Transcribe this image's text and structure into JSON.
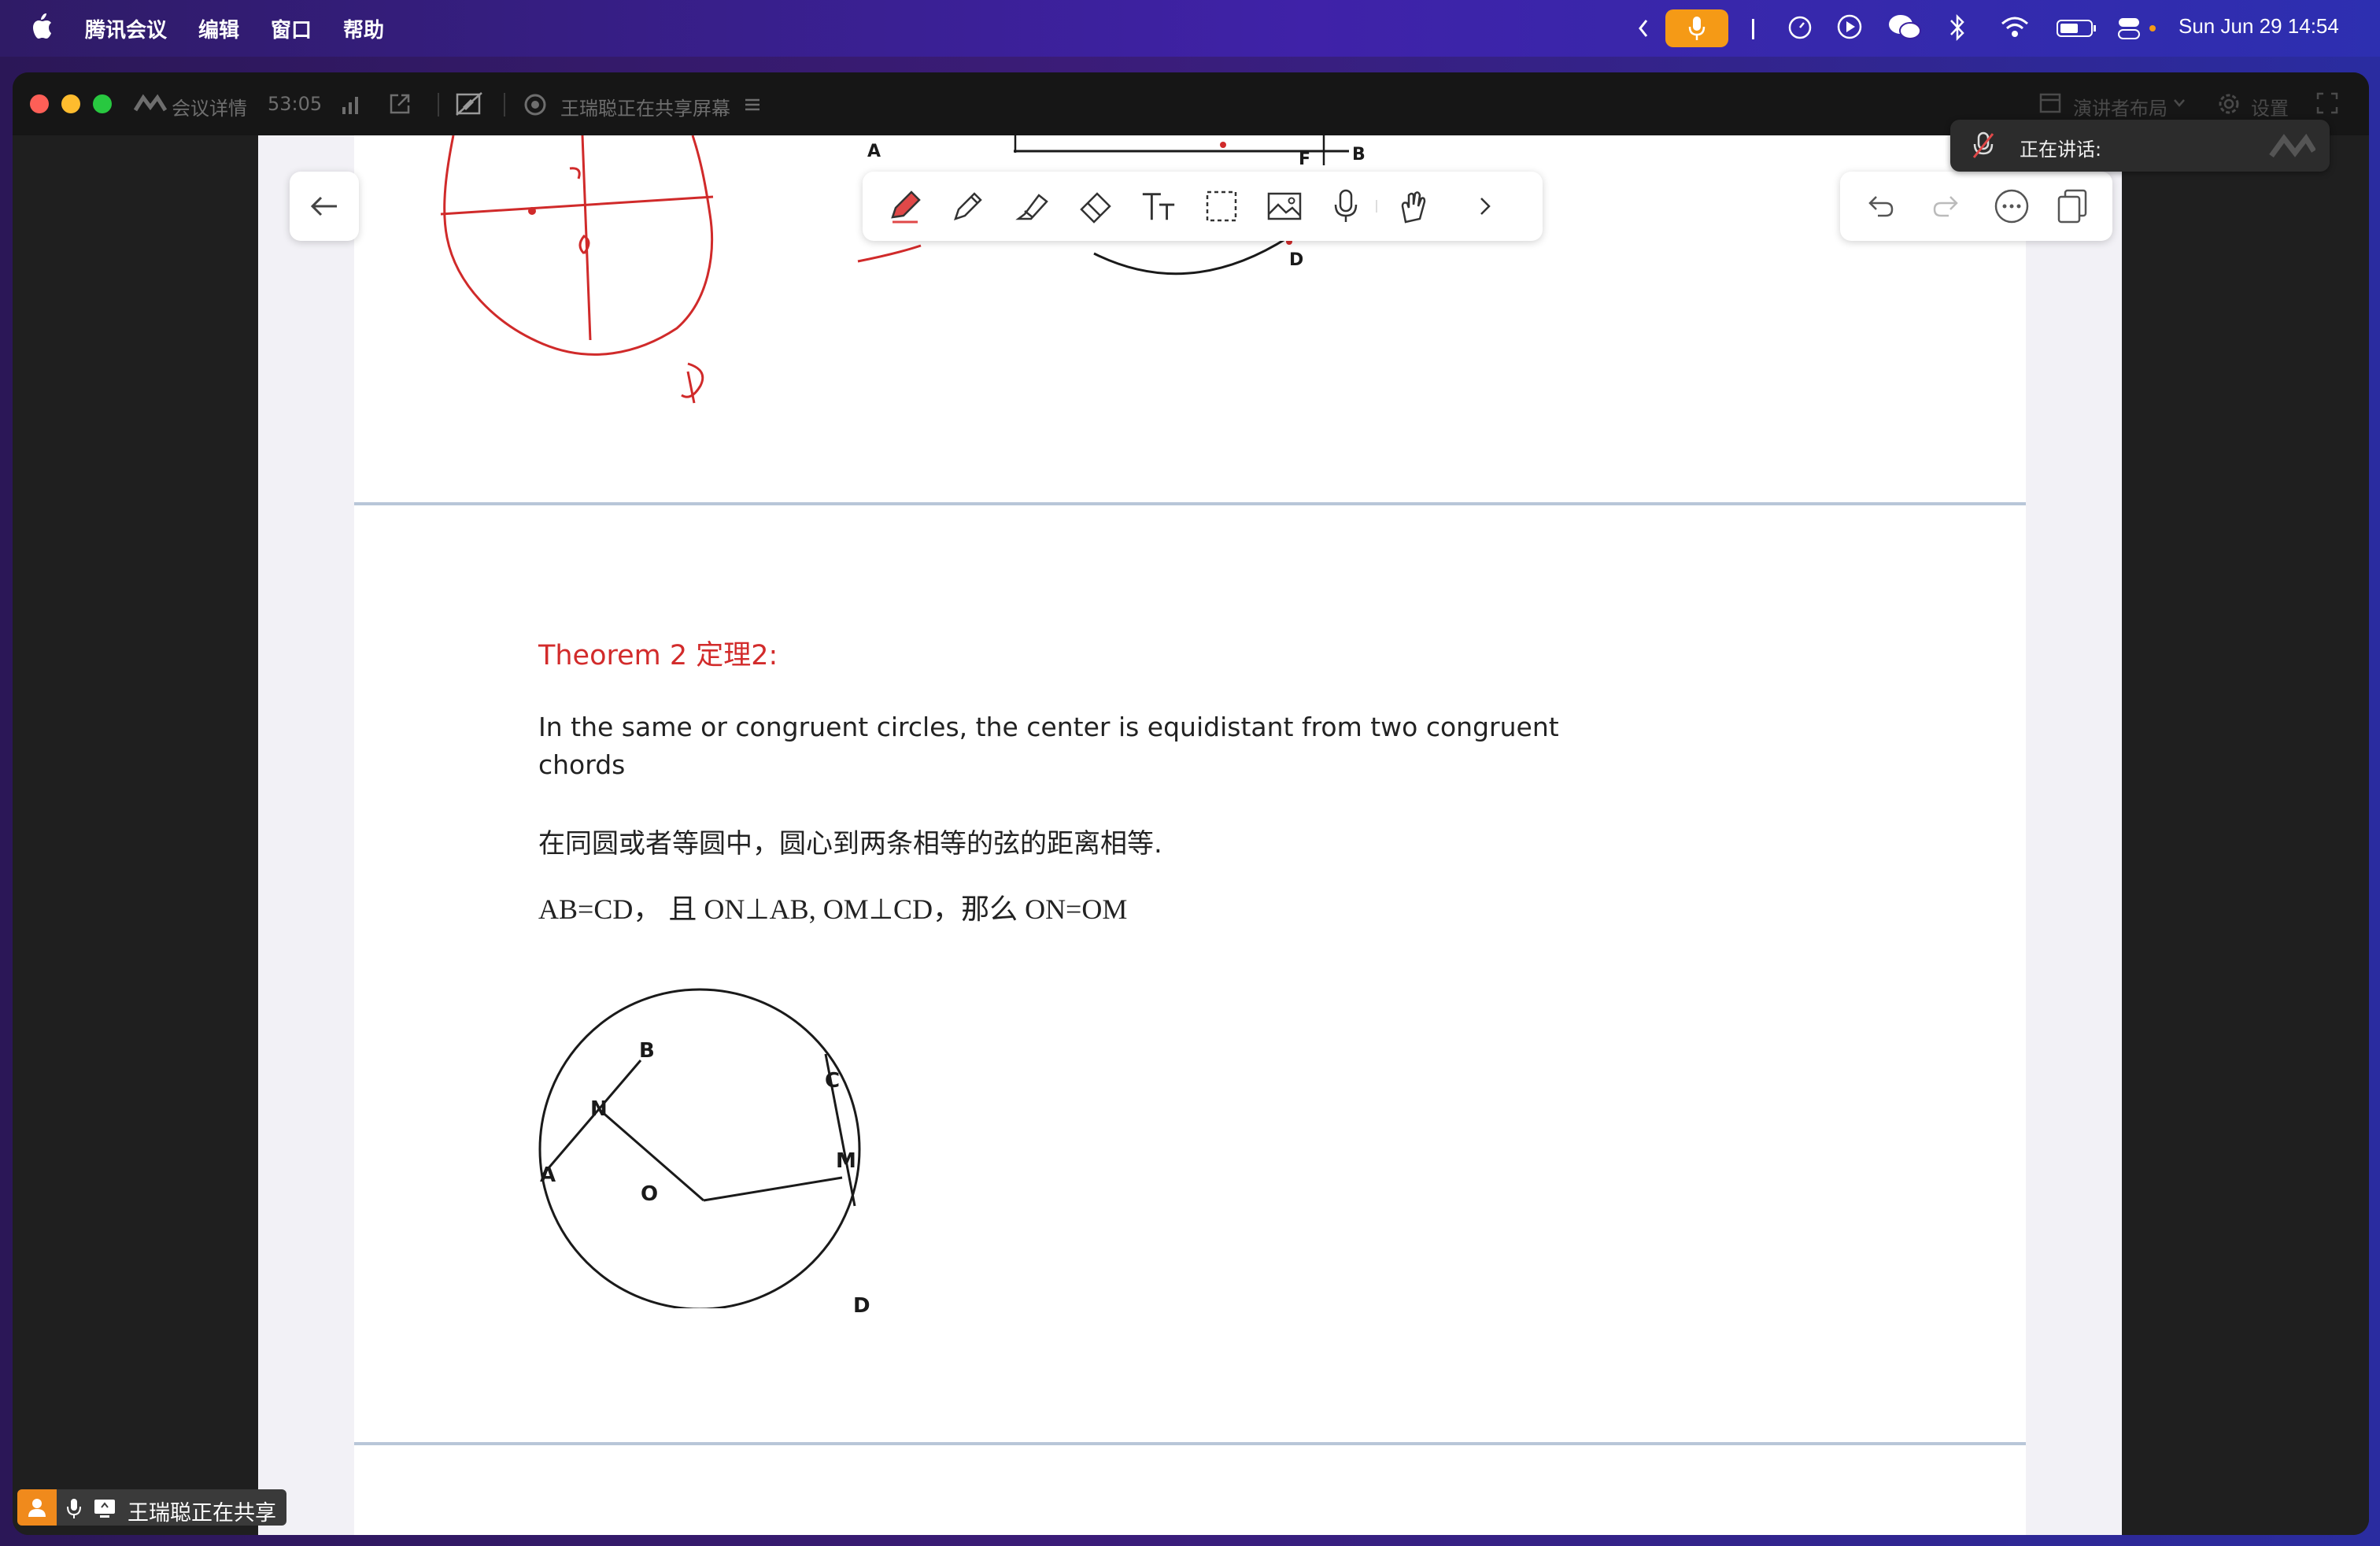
{
  "menubar": {
    "app_name": "腾讯会议",
    "menus": [
      "编辑",
      "窗口",
      "帮助"
    ],
    "clock": "Sun Jun 29  14:54",
    "mic_active_color": "#f59a16"
  },
  "window": {
    "meeting_details_label": "会议详情",
    "meeting_duration": "53:05",
    "sharing_status": "王瑞聪正在共享屏幕",
    "presenter_layout_label": "演讲者布局",
    "settings_label": "设置"
  },
  "speaking_popup": {
    "label": "正在讲话:"
  },
  "whiteboard": {
    "tools": [
      "pen-icon",
      "pencil-icon",
      "highlighter-icon",
      "eraser-icon",
      "text-icon",
      "select-icon",
      "image-icon",
      "mic-icon",
      "laser-hand-icon",
      "chevron-right-icon"
    ],
    "active_tool": "pen-icon",
    "actions": [
      "undo-icon",
      "redo-icon",
      "more-icon",
      "copy-pages-icon"
    ]
  },
  "document": {
    "top_figure_labels": {
      "a": "A",
      "b": "B",
      "f": "F",
      "d": "D"
    },
    "theorem_title": "Theorem 2 定理2:",
    "theorem_en": "In the same or congruent circles, the center is equidistant from two congruent chords",
    "theorem_cn": "在同圆或者等圆中，圆心到两条相等的弦的距离相等.",
    "theorem_eq": "AB=CD，  且 ON⊥AB, OM⊥CD，那么 ON=OM",
    "diagram_labels": {
      "a": "A",
      "b": "B",
      "c": "C",
      "d": "D",
      "m": "M",
      "n": "N",
      "o": "O"
    }
  },
  "share_badge": {
    "text": "王瑞聪正在共享"
  }
}
